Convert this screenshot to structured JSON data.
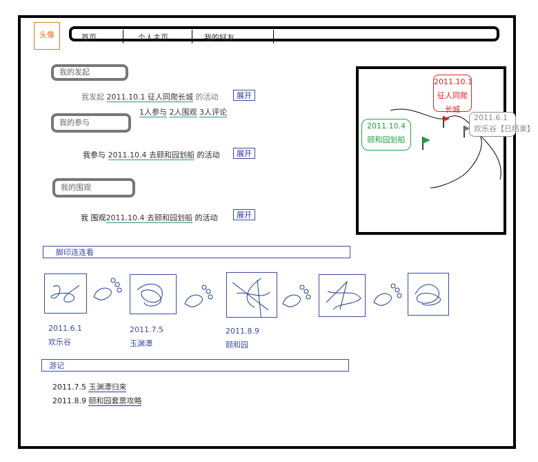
{
  "header": {
    "avatar_label": "头像",
    "nav": [
      "首页",
      "个人主页",
      "我的好友"
    ]
  },
  "initiated": {
    "heading": "我的发起",
    "prefix": "我发起",
    "activity": "2011.10.1  征人同爬长城",
    "suffix": "的活动",
    "expand": "展开",
    "stats": [
      "1人参与",
      "2人围观",
      "3人评论"
    ]
  },
  "joined": {
    "heading": "我的参与",
    "prefix": "我参与",
    "activity": "2011.10.4 去颐和园划船",
    "suffix": "的活动",
    "expand": "展开"
  },
  "watched": {
    "heading": "我的围观",
    "prefix": "我 围观",
    "activity": "2011.10.4 去颐和园划船",
    "suffix": "的活动",
    "expand": "展开"
  },
  "map": {
    "markers": [
      {
        "date": "2011.10.1",
        "name": "征人同爬长城",
        "color": "#e02020"
      },
      {
        "date": "2011.10.4",
        "name": "颐和园划船",
        "color": "#20a040"
      },
      {
        "date": "2011.6.1",
        "name": "欢乐谷【已结束】",
        "color": "#888888"
      }
    ]
  },
  "footprints": {
    "heading": "脚印连连看",
    "items": [
      {
        "date": "2011.6.1",
        "place": "欢乐谷"
      },
      {
        "date": "2011.7.5",
        "place": "玉渊潭"
      },
      {
        "date": "2011.8.9",
        "place": "颐和园"
      }
    ]
  },
  "travel": {
    "heading": "游记",
    "entries": [
      {
        "date": "2011.7.5",
        "title": "玉渊潭归来"
      },
      {
        "date": "2011.8.9",
        "title": "颐和园套票攻略"
      }
    ]
  }
}
